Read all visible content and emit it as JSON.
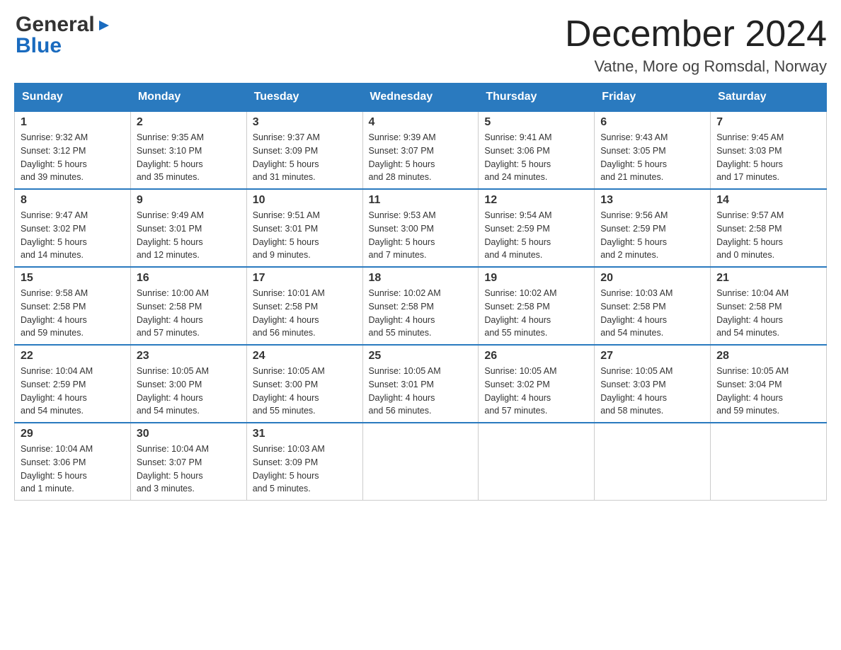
{
  "logo": {
    "general": "General",
    "blue": "Blue",
    "arrow": "▶"
  },
  "header": {
    "month": "December 2024",
    "location": "Vatne, More og Romsdal, Norway"
  },
  "days_of_week": [
    "Sunday",
    "Monday",
    "Tuesday",
    "Wednesday",
    "Thursday",
    "Friday",
    "Saturday"
  ],
  "weeks": [
    [
      {
        "day": "1",
        "sunrise": "Sunrise: 9:32 AM",
        "sunset": "Sunset: 3:12 PM",
        "daylight": "Daylight: 5 hours",
        "minutes": "and 39 minutes."
      },
      {
        "day": "2",
        "sunrise": "Sunrise: 9:35 AM",
        "sunset": "Sunset: 3:10 PM",
        "daylight": "Daylight: 5 hours",
        "minutes": "and 35 minutes."
      },
      {
        "day": "3",
        "sunrise": "Sunrise: 9:37 AM",
        "sunset": "Sunset: 3:09 PM",
        "daylight": "Daylight: 5 hours",
        "minutes": "and 31 minutes."
      },
      {
        "day": "4",
        "sunrise": "Sunrise: 9:39 AM",
        "sunset": "Sunset: 3:07 PM",
        "daylight": "Daylight: 5 hours",
        "minutes": "and 28 minutes."
      },
      {
        "day": "5",
        "sunrise": "Sunrise: 9:41 AM",
        "sunset": "Sunset: 3:06 PM",
        "daylight": "Daylight: 5 hours",
        "minutes": "and 24 minutes."
      },
      {
        "day": "6",
        "sunrise": "Sunrise: 9:43 AM",
        "sunset": "Sunset: 3:05 PM",
        "daylight": "Daylight: 5 hours",
        "minutes": "and 21 minutes."
      },
      {
        "day": "7",
        "sunrise": "Sunrise: 9:45 AM",
        "sunset": "Sunset: 3:03 PM",
        "daylight": "Daylight: 5 hours",
        "minutes": "and 17 minutes."
      }
    ],
    [
      {
        "day": "8",
        "sunrise": "Sunrise: 9:47 AM",
        "sunset": "Sunset: 3:02 PM",
        "daylight": "Daylight: 5 hours",
        "minutes": "and 14 minutes."
      },
      {
        "day": "9",
        "sunrise": "Sunrise: 9:49 AM",
        "sunset": "Sunset: 3:01 PM",
        "daylight": "Daylight: 5 hours",
        "minutes": "and 12 minutes."
      },
      {
        "day": "10",
        "sunrise": "Sunrise: 9:51 AM",
        "sunset": "Sunset: 3:01 PM",
        "daylight": "Daylight: 5 hours",
        "minutes": "and 9 minutes."
      },
      {
        "day": "11",
        "sunrise": "Sunrise: 9:53 AM",
        "sunset": "Sunset: 3:00 PM",
        "daylight": "Daylight: 5 hours",
        "minutes": "and 7 minutes."
      },
      {
        "day": "12",
        "sunrise": "Sunrise: 9:54 AM",
        "sunset": "Sunset: 2:59 PM",
        "daylight": "Daylight: 5 hours",
        "minutes": "and 4 minutes."
      },
      {
        "day": "13",
        "sunrise": "Sunrise: 9:56 AM",
        "sunset": "Sunset: 2:59 PM",
        "daylight": "Daylight: 5 hours",
        "minutes": "and 2 minutes."
      },
      {
        "day": "14",
        "sunrise": "Sunrise: 9:57 AM",
        "sunset": "Sunset: 2:58 PM",
        "daylight": "Daylight: 5 hours",
        "minutes": "and 0 minutes."
      }
    ],
    [
      {
        "day": "15",
        "sunrise": "Sunrise: 9:58 AM",
        "sunset": "Sunset: 2:58 PM",
        "daylight": "Daylight: 4 hours",
        "minutes": "and 59 minutes."
      },
      {
        "day": "16",
        "sunrise": "Sunrise: 10:00 AM",
        "sunset": "Sunset: 2:58 PM",
        "daylight": "Daylight: 4 hours",
        "minutes": "and 57 minutes."
      },
      {
        "day": "17",
        "sunrise": "Sunrise: 10:01 AM",
        "sunset": "Sunset: 2:58 PM",
        "daylight": "Daylight: 4 hours",
        "minutes": "and 56 minutes."
      },
      {
        "day": "18",
        "sunrise": "Sunrise: 10:02 AM",
        "sunset": "Sunset: 2:58 PM",
        "daylight": "Daylight: 4 hours",
        "minutes": "and 55 minutes."
      },
      {
        "day": "19",
        "sunrise": "Sunrise: 10:02 AM",
        "sunset": "Sunset: 2:58 PM",
        "daylight": "Daylight: 4 hours",
        "minutes": "and 55 minutes."
      },
      {
        "day": "20",
        "sunrise": "Sunrise: 10:03 AM",
        "sunset": "Sunset: 2:58 PM",
        "daylight": "Daylight: 4 hours",
        "minutes": "and 54 minutes."
      },
      {
        "day": "21",
        "sunrise": "Sunrise: 10:04 AM",
        "sunset": "Sunset: 2:58 PM",
        "daylight": "Daylight: 4 hours",
        "minutes": "and 54 minutes."
      }
    ],
    [
      {
        "day": "22",
        "sunrise": "Sunrise: 10:04 AM",
        "sunset": "Sunset: 2:59 PM",
        "daylight": "Daylight: 4 hours",
        "minutes": "and 54 minutes."
      },
      {
        "day": "23",
        "sunrise": "Sunrise: 10:05 AM",
        "sunset": "Sunset: 3:00 PM",
        "daylight": "Daylight: 4 hours",
        "minutes": "and 54 minutes."
      },
      {
        "day": "24",
        "sunrise": "Sunrise: 10:05 AM",
        "sunset": "Sunset: 3:00 PM",
        "daylight": "Daylight: 4 hours",
        "minutes": "and 55 minutes."
      },
      {
        "day": "25",
        "sunrise": "Sunrise: 10:05 AM",
        "sunset": "Sunset: 3:01 PM",
        "daylight": "Daylight: 4 hours",
        "minutes": "and 56 minutes."
      },
      {
        "day": "26",
        "sunrise": "Sunrise: 10:05 AM",
        "sunset": "Sunset: 3:02 PM",
        "daylight": "Daylight: 4 hours",
        "minutes": "and 57 minutes."
      },
      {
        "day": "27",
        "sunrise": "Sunrise: 10:05 AM",
        "sunset": "Sunset: 3:03 PM",
        "daylight": "Daylight: 4 hours",
        "minutes": "and 58 minutes."
      },
      {
        "day": "28",
        "sunrise": "Sunrise: 10:05 AM",
        "sunset": "Sunset: 3:04 PM",
        "daylight": "Daylight: 4 hours",
        "minutes": "and 59 minutes."
      }
    ],
    [
      {
        "day": "29",
        "sunrise": "Sunrise: 10:04 AM",
        "sunset": "Sunset: 3:06 PM",
        "daylight": "Daylight: 5 hours",
        "minutes": "and 1 minute."
      },
      {
        "day": "30",
        "sunrise": "Sunrise: 10:04 AM",
        "sunset": "Sunset: 3:07 PM",
        "daylight": "Daylight: 5 hours",
        "minutes": "and 3 minutes."
      },
      {
        "day": "31",
        "sunrise": "Sunrise: 10:03 AM",
        "sunset": "Sunset: 3:09 PM",
        "daylight": "Daylight: 5 hours",
        "minutes": "and 5 minutes."
      },
      null,
      null,
      null,
      null
    ]
  ]
}
